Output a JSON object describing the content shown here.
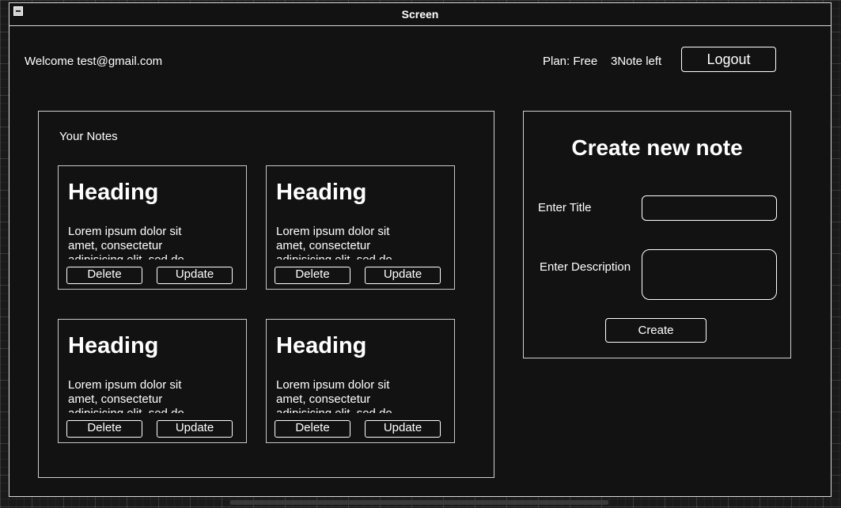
{
  "window": {
    "title": "Screen"
  },
  "header": {
    "welcome": "Welcome test@gmail.com",
    "plan": "Plan: Free",
    "notes_left": "3Note left",
    "logout_label": "Logout"
  },
  "notes_panel": {
    "title": "Your Notes",
    "notes": [
      {
        "heading": "Heading",
        "body": "Lorem ipsum dolor sit amet, consectetur adipisicing elit, sed do",
        "delete_label": "Delete",
        "update_label": "Update"
      },
      {
        "heading": "Heading",
        "body": "Lorem ipsum dolor sit amet, consectetur adipisicing elit, sed do",
        "delete_label": "Delete",
        "update_label": "Update"
      },
      {
        "heading": "Heading",
        "body": "Lorem ipsum dolor sit amet, consectetur adipisicing elit, sed do",
        "delete_label": "Delete",
        "update_label": "Update"
      },
      {
        "heading": "Heading",
        "body": "Lorem ipsum dolor sit amet, consectetur adipisicing elit, sed do",
        "delete_label": "Delete",
        "update_label": "Update"
      }
    ]
  },
  "create_panel": {
    "title": "Create new note",
    "title_label": "Enter Title",
    "title_value": "",
    "description_label": "Enter Description",
    "description_value": "",
    "create_label": "Create"
  },
  "colors": {
    "background": "#121212",
    "border": "#d8d8d8",
    "text": "#ffffff"
  }
}
